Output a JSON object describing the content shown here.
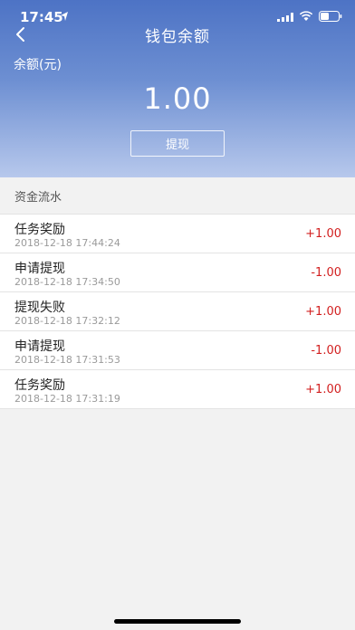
{
  "status": {
    "time": "17:45",
    "icons": [
      "location-arrow-icon",
      "signal-icon",
      "wifi-icon",
      "battery-icon"
    ]
  },
  "nav": {
    "title": "钱包余额",
    "back_icon": "chevron-left-icon"
  },
  "balance": {
    "label": "余额(元)",
    "amount": "1.00",
    "withdraw_label": "提现"
  },
  "section": {
    "title": "资金流水"
  },
  "transactions": [
    {
      "title": "任务奖励",
      "time": "2018-12-18 17:44:24",
      "amount": "+1.00"
    },
    {
      "title": "申请提现",
      "time": "2018-12-18 17:34:50",
      "amount": "-1.00"
    },
    {
      "title": "提现失败",
      "time": "2018-12-18 17:32:12",
      "amount": "+1.00"
    },
    {
      "title": "申请提现",
      "time": "2018-12-18 17:31:53",
      "amount": "-1.00"
    },
    {
      "title": "任务奖励",
      "time": "2018-12-18 17:31:19",
      "amount": "+1.00"
    }
  ],
  "colors": {
    "header_top": "#4d73c5",
    "header_bottom": "#b7c8ec",
    "amount_red": "#d21f1f",
    "background": "#f2f2f2"
  }
}
